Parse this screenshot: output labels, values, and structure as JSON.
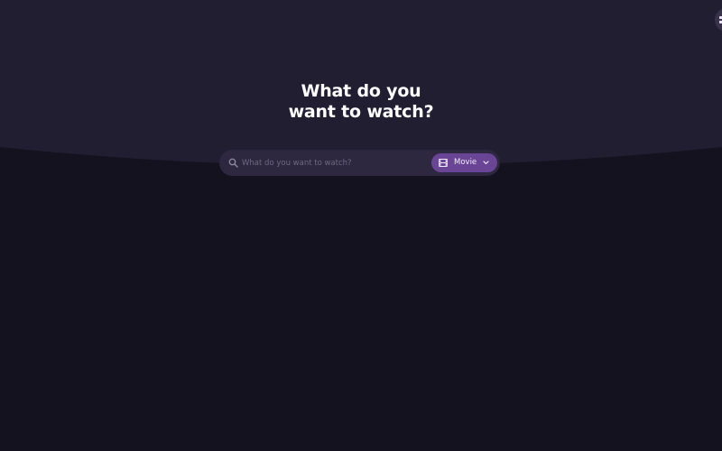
{
  "hero": {
    "title_line1": "What do you",
    "title_line2": "want to watch?"
  },
  "search": {
    "placeholder": "What do you want to watch?",
    "value": "",
    "icon": "search-icon"
  },
  "media_type": {
    "selected_label": "Movie",
    "icon": "film-icon",
    "dropdown_icon": "chevron-down-icon"
  },
  "corner_menu": {
    "icon": "menu-icon"
  },
  "colors": {
    "page_background": "#13121e",
    "hero_background": "#211e32",
    "search_background": "#2d2740",
    "accent": "#6a4596",
    "text_primary": "#ffffff",
    "text_placeholder": "#6f6985"
  }
}
